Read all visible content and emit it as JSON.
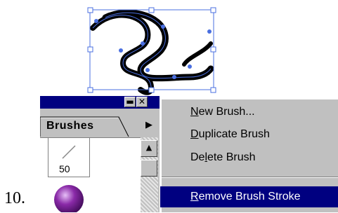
{
  "step": {
    "number": "10."
  },
  "palette": {
    "tab_label": "Brushes",
    "minimize_icon": "minimize-icon",
    "close_icon": "close-icon",
    "flyout_icon": "triangle-right-icon",
    "scroll_up_icon": "triangle-up-icon",
    "swatch_value": "50"
  },
  "context_menu": {
    "items": [
      {
        "mnemonic": "N",
        "rest": "ew Brush..."
      },
      {
        "mnemonic": "D",
        "rest": "uplicate Brush"
      },
      {
        "pre": "De",
        "mnemonic": "l",
        "rest": "ete Brush"
      },
      {
        "mnemonic": "R",
        "rest": "emove Brush Stroke"
      }
    ],
    "selected_index": 3
  },
  "colors": {
    "selection_blue": "#4a6fe0",
    "titlebar": "#000080",
    "pointer_arrow": "#8b1a3a",
    "sphere": "#8a2aa8"
  }
}
